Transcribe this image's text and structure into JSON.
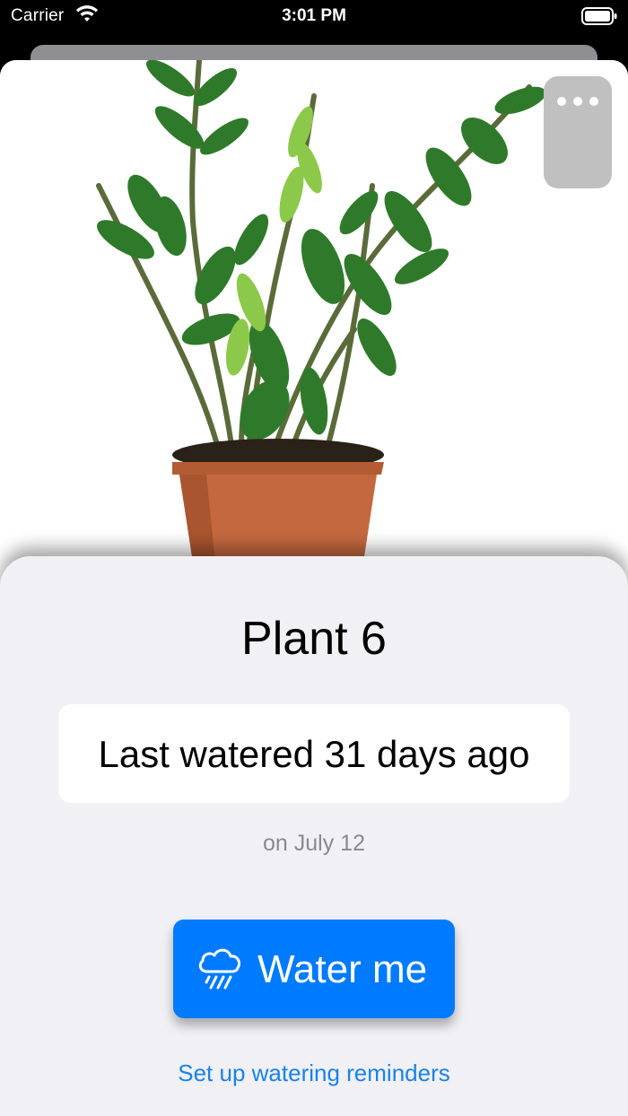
{
  "status_bar": {
    "carrier": "Carrier",
    "time": "3:01 PM",
    "wifi_icon": "wifi-icon",
    "battery_icon": "battery-icon"
  },
  "plant": {
    "name": "Plant 6",
    "image_icon": "plant-photo",
    "last_watered": "Last watered 31 days ago",
    "watered_date": "on July 12"
  },
  "actions": {
    "more_icon": "ellipsis-icon",
    "water_button_label": "Water me",
    "water_icon": "cloud-rain-icon",
    "reminders_link": "Set up watering reminders"
  },
  "colors": {
    "accent": "#007aff",
    "link": "#1a82e6",
    "panel_bg": "#f0f0f5",
    "secondary_text": "#8a8a8e"
  }
}
